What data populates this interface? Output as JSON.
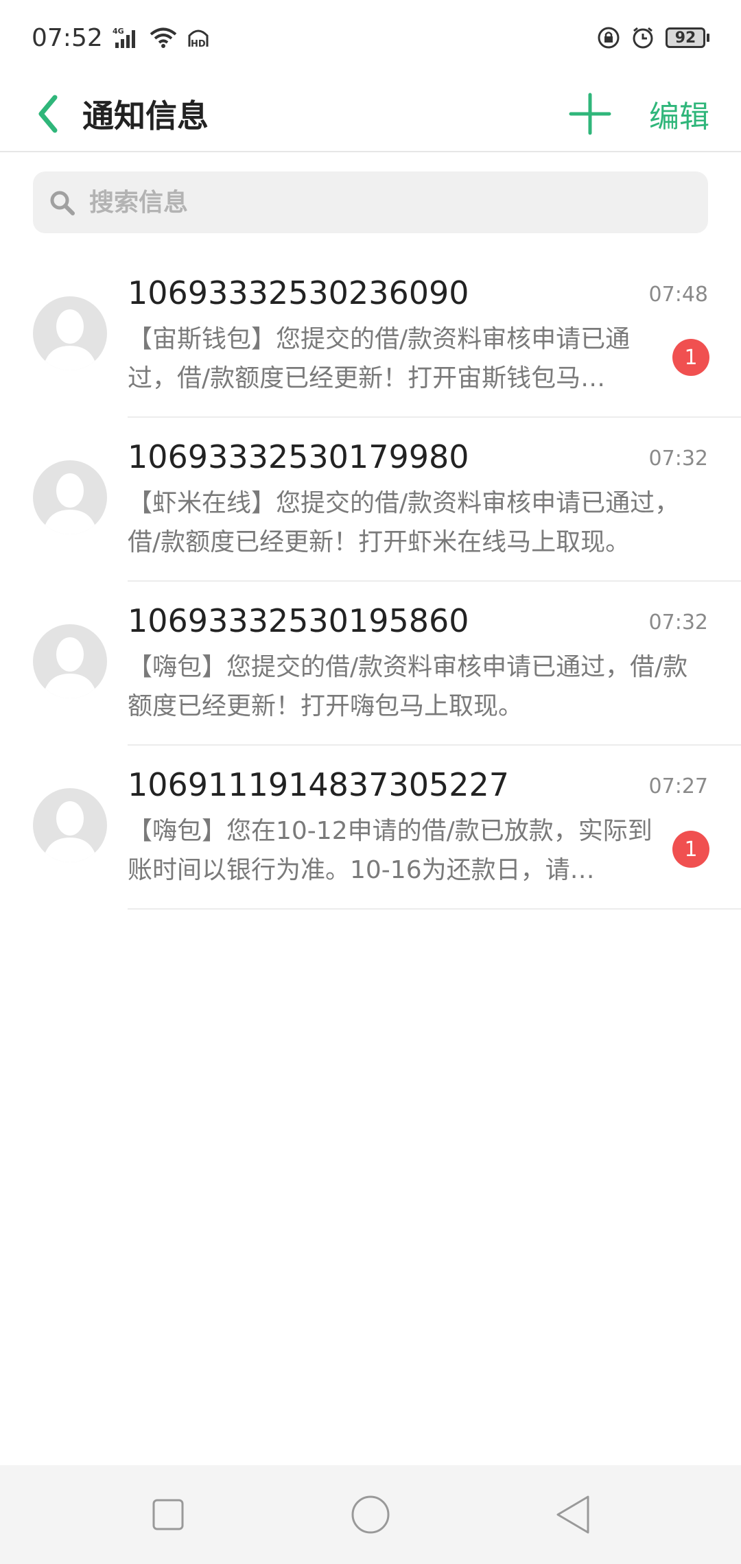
{
  "status_bar": {
    "time": "07:52",
    "network": "4G",
    "battery": "92",
    "icons": [
      "signal-icon",
      "wifi-icon",
      "hd-icon",
      "lock-rotation-icon",
      "alarm-icon",
      "battery-icon"
    ]
  },
  "header": {
    "title": "通知信息",
    "edit_label": "编辑",
    "accent_color": "#2fb67a"
  },
  "search": {
    "placeholder": "搜索信息"
  },
  "messages": [
    {
      "sender": "10693332530236090",
      "time": "07:48",
      "preview": "【宙斯钱包】您提交的借/款资料审核申请已通过，借/款额度已经更新！打开宙斯钱包马…",
      "unread": "1"
    },
    {
      "sender": "10693332530179980",
      "time": "07:32",
      "preview": "【虾米在线】您提交的借/款资料审核申请已通过，借/款额度已经更新！打开虾米在线马上取现。",
      "unread": ""
    },
    {
      "sender": "10693332530195860",
      "time": "07:32",
      "preview": "【嗨包】您提交的借/款资料审核申请已通过，借/款额度已经更新！打开嗨包马上取现。",
      "unread": ""
    },
    {
      "sender": "1069111914837305227",
      "time": "07:27",
      "preview": "【嗨包】您在10-12申请的借/款已放款，实际到账时间以银行为准。10-16为还款日，请…",
      "unread": "1"
    }
  ],
  "colors": {
    "badge": "#f05050",
    "avatar_bg": "#e3e3e3"
  }
}
